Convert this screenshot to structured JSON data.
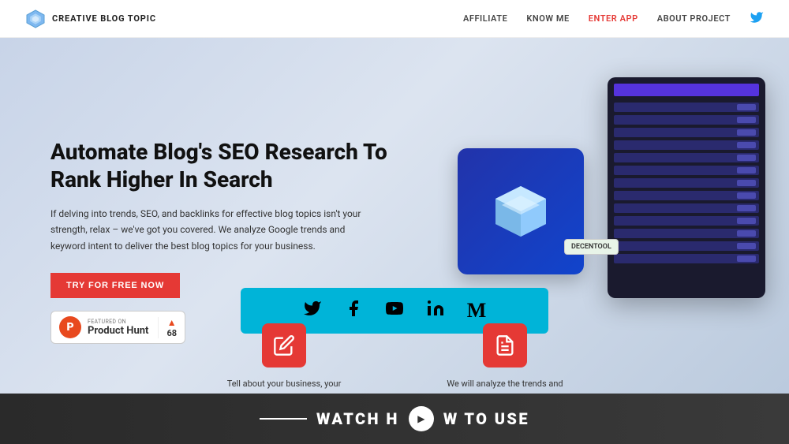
{
  "nav": {
    "brand": "CREATIVE BLOG TOPIC",
    "links": [
      {
        "label": "AFFILIATE",
        "active": false
      },
      {
        "label": "KNOW ME",
        "active": false
      },
      {
        "label": "ENTER APP",
        "active": true
      },
      {
        "label": "ABOUT PROJECT",
        "active": false
      }
    ],
    "twitter_label": "twitter-icon"
  },
  "hero": {
    "title": "Automate Blog's SEO Research To Rank Higher In Search",
    "description": "If delving into trends, SEO, and backlinks for effective blog topics isn't your strength, relax – we've got you covered. We analyze Google trends and keyword intent to deliver the best blog topics for your business.",
    "cta_label": "TRY FOR FREE NOW",
    "product_hunt": {
      "featured_text": "FEATURED ON",
      "name": "Product Hunt",
      "votes": "68"
    }
  },
  "decentool_badge": "DECENTOOL",
  "social_bar": {
    "icons": [
      "twitter",
      "facebook",
      "youtube",
      "linkedin",
      "medium"
    ]
  },
  "features": [
    {
      "icon": "✏️",
      "text": "Tell about your business, your customers and the location"
    },
    {
      "icon": "📰",
      "text": "We will analyze the trends and give you the best blog title"
    }
  ],
  "watch_section": {
    "label": "WATCH HOW TO USE"
  }
}
